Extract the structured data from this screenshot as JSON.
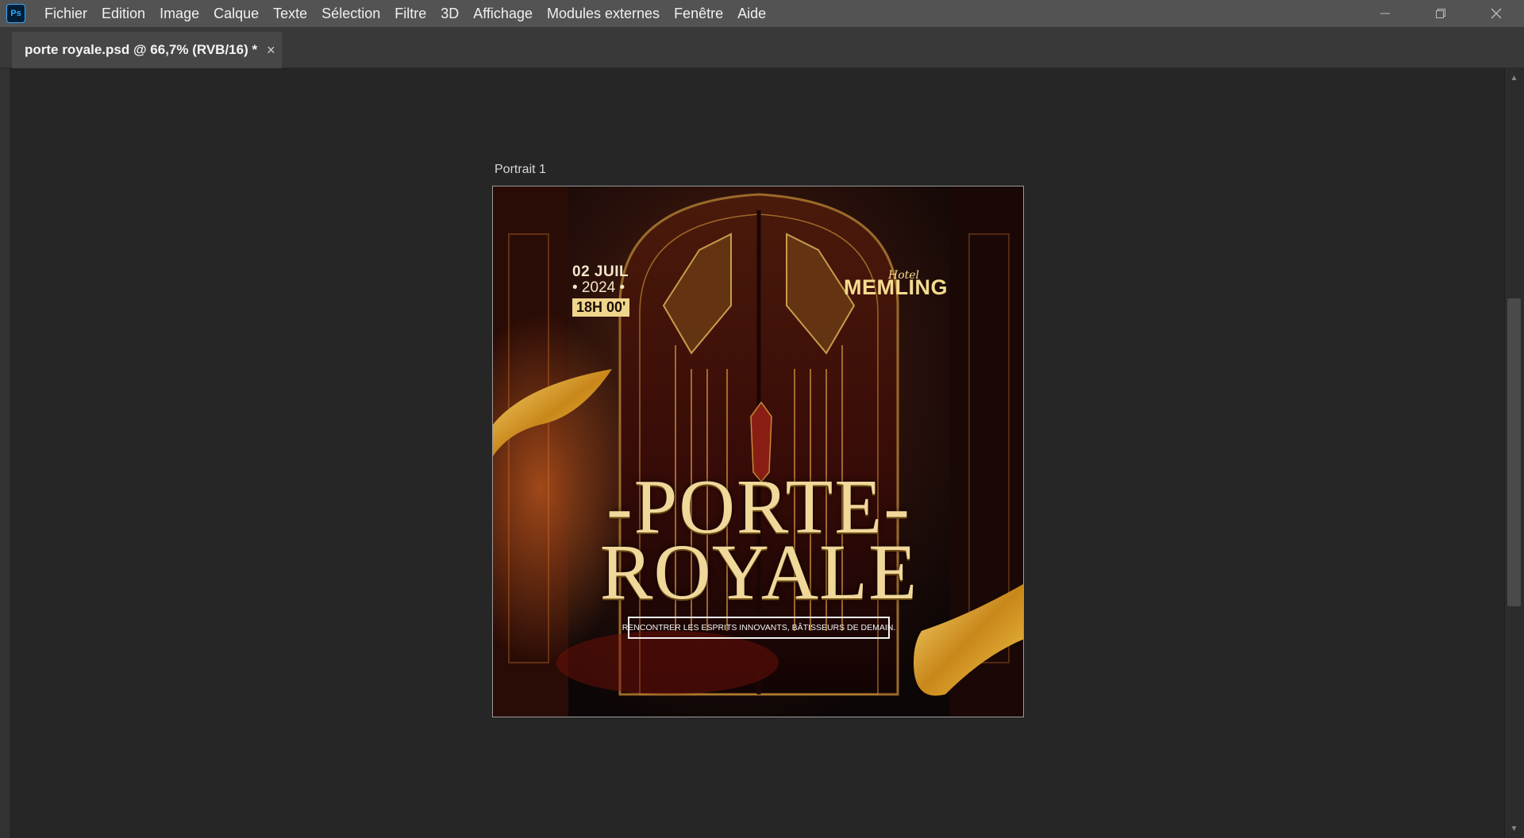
{
  "app": {
    "logo_text": "Ps"
  },
  "menu": [
    "Fichier",
    "Edition",
    "Image",
    "Calque",
    "Texte",
    "Sélection",
    "Filtre",
    "3D",
    "Affichage",
    "Modules externes",
    "Fenêtre",
    "Aide"
  ],
  "tab": {
    "title": "porte royale.psd @ 66,7% (RVB/16) *",
    "close": "×"
  },
  "artboard": {
    "label": "Portrait 1"
  },
  "poster": {
    "date_day": "02 JUIL",
    "date_year": "• 2024 •",
    "date_time": "18H 00'",
    "brand_script": "Hotel",
    "brand": "MEMLING",
    "title_line1": "-PORTE-",
    "title_line2": "ROYALE",
    "tagline": "RENCONTRER LES ESPRITS INNOVANTS, BÂTISSEURS DE DEMAIN."
  },
  "colors": {
    "menubar": "#535353",
    "workspace": "#262626",
    "gold": "#f0d89b",
    "ps_blue": "#31a8ff"
  }
}
